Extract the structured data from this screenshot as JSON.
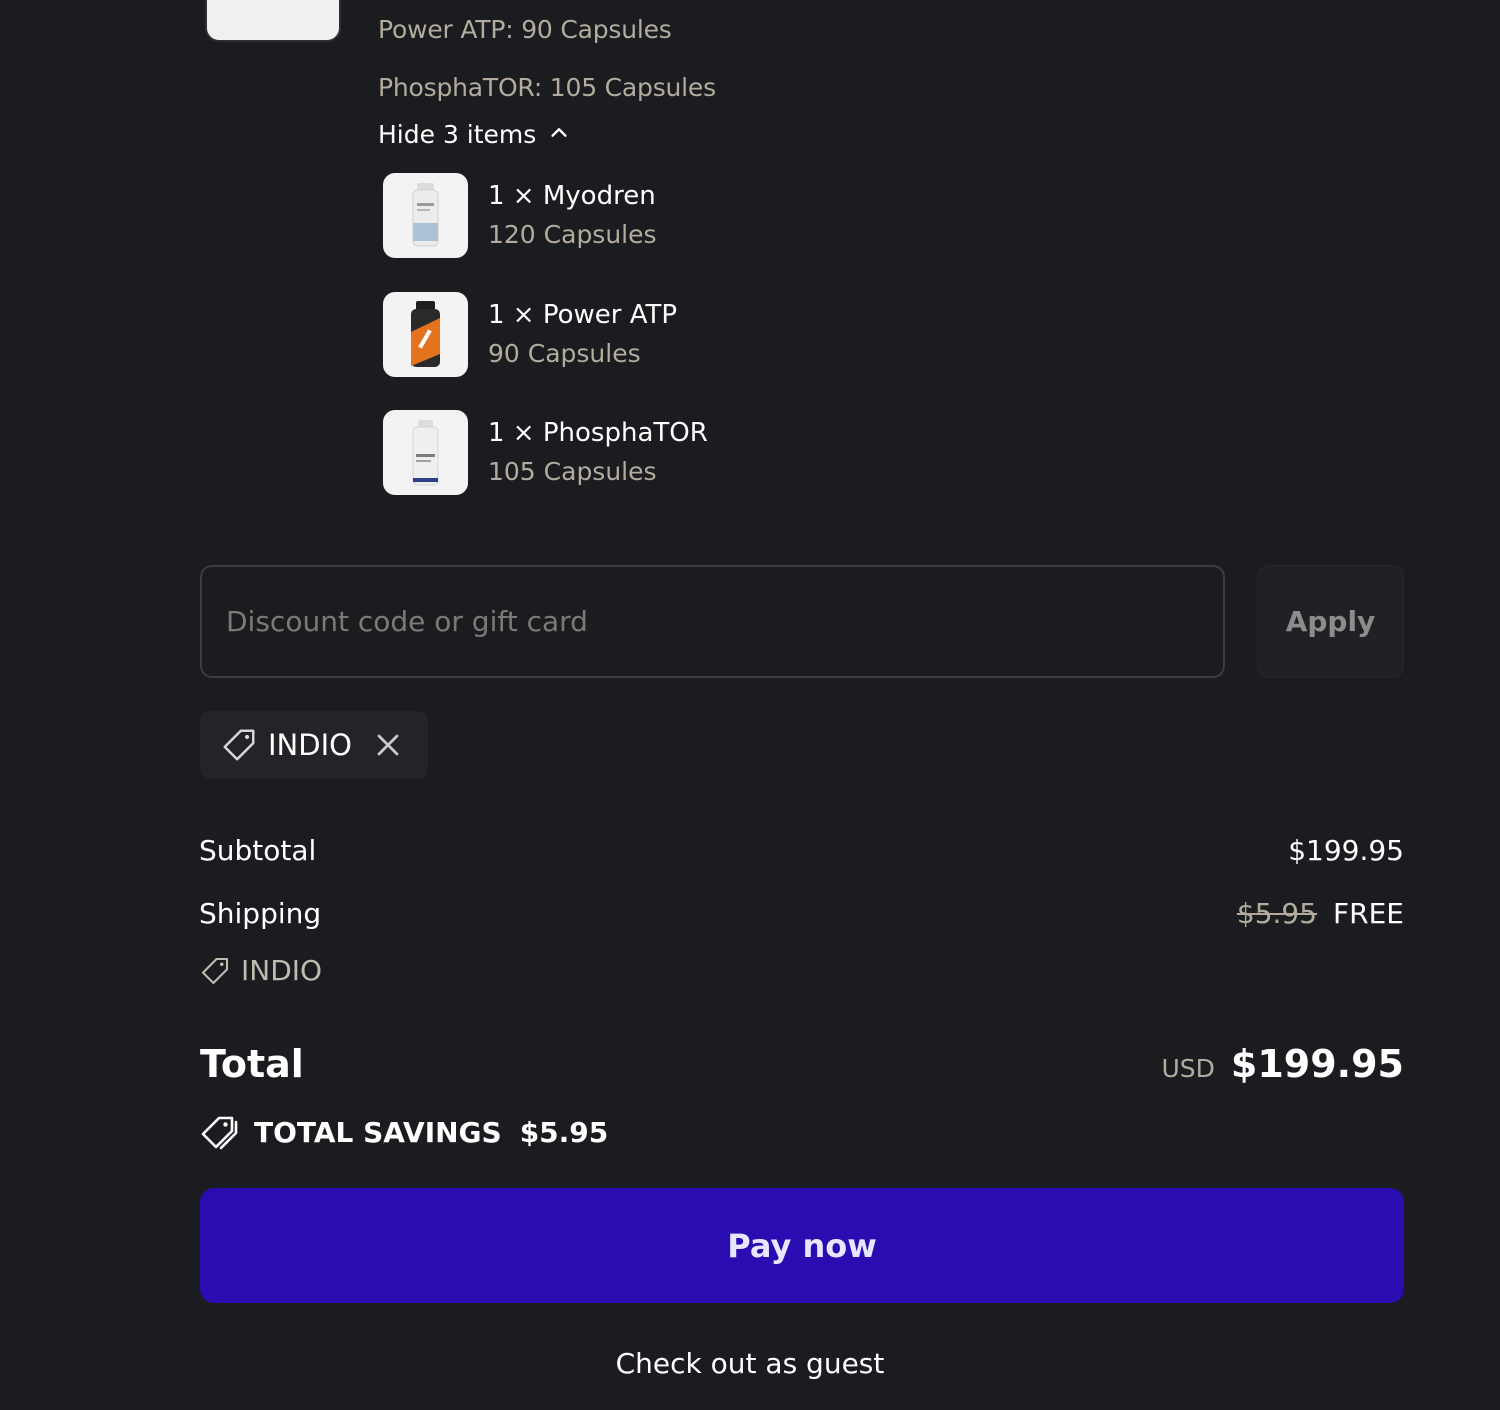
{
  "bundle_variants": [
    "Power ATP: 90 Capsules",
    "PhosphaTOR: 105 Capsules"
  ],
  "toggle": {
    "label": "Hide 3 items",
    "icon": "chevron-up-icon"
  },
  "bundle_items": [
    {
      "name": "1 × Myodren",
      "variant": "120 Capsules"
    },
    {
      "name": "1 × Power ATP",
      "variant": "90 Capsules"
    },
    {
      "name": "1 × PhosphaTOR",
      "variant": "105 Capsules"
    }
  ],
  "discount": {
    "placeholder": "Discount code or gift card",
    "value": "",
    "apply_label": "Apply",
    "applied_code": "INDIO"
  },
  "summary": {
    "subtotal_label": "Subtotal",
    "subtotal_value": "$199.95",
    "shipping_label": "Shipping",
    "shipping_original": "$5.95",
    "shipping_value": "FREE",
    "shipping_discount_code": "INDIO",
    "total_label": "Total",
    "total_currency": "USD",
    "total_value": "$199.95",
    "savings_label": "TOTAL SAVINGS",
    "savings_value": "$5.95"
  },
  "actions": {
    "pay_label": "Pay now",
    "guest_label": "Check out as guest"
  },
  "colors": {
    "background": "#1a1c1f",
    "pay_button": "#2a0cb0",
    "muted_text": "#b3ab9e"
  }
}
